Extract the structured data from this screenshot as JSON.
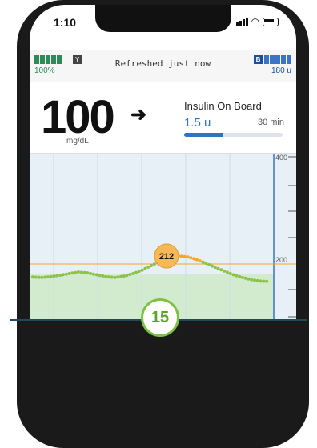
{
  "status": {
    "time": "1:10",
    "refreshed": "Refreshed just now",
    "pump_battery": "100%",
    "insulin_badge": "B",
    "insulin_units": "180 u"
  },
  "bg": {
    "value": "100",
    "unit": "mg/dL",
    "trend": "➜"
  },
  "iob": {
    "label": "Insulin On Board",
    "value": "1.5 u",
    "time": "30 min",
    "progress": 0.4
  },
  "chart_data": {
    "type": "scatter",
    "y_ticks": [
      "400",
      "200"
    ],
    "high_threshold": 212,
    "target_upper": 180,
    "peak_label": "212",
    "series": [
      {
        "values": [
          120,
          118,
          122,
          128,
          135,
          142,
          138,
          130,
          122,
          118,
          124,
          135,
          150,
          170,
          190,
          205,
          212,
          208,
          196,
          180,
          162,
          146,
          130,
          118,
          108,
          102,
          100
        ]
      }
    ],
    "colors": {
      "in_range": "#8bc34a",
      "high": "#f5a623",
      "band": "#d2ebcf"
    }
  },
  "footer_badge": "15"
}
